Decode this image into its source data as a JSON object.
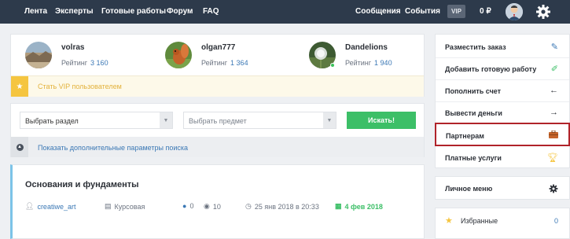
{
  "nav": {
    "links": [
      "Лента",
      "Эксперты",
      "Готовые работы",
      "Форум",
      "FAQ"
    ],
    "messages": "Сообщения",
    "events": "События",
    "vip": "VIP",
    "balance": "0 ₽",
    "settings_icon": "gear-icon"
  },
  "authors": [
    {
      "name": "volras",
      "rating_label": "Рейтинг",
      "rating": "3 160"
    },
    {
      "name": "olgan777",
      "rating_label": "Рейтинг",
      "rating": "1 364"
    },
    {
      "name": "Dandelions",
      "rating_label": "Рейтинг",
      "rating": "1 940"
    }
  ],
  "vip_banner": "Стать VIP пользователем",
  "search": {
    "section_placeholder": "Выбрать раздел",
    "subject_placeholder": "Выбрать предмет",
    "button": "Искать!",
    "more_params": "Показать дополнительные параметры поиска"
  },
  "work": {
    "title": "Основания и фундаменты",
    "author": "creatiwe_art",
    "type": "Курсовая",
    "comments": "0",
    "views": "10",
    "date": "25 янв 2018 в 20:33",
    "deadline": "4 фев 2018"
  },
  "sidebar": {
    "items": [
      {
        "label": "Разместить заказ",
        "icon": "pencil-icon"
      },
      {
        "label": "Добавить готовую работу",
        "icon": "paperclip-icon"
      },
      {
        "label": "Пополнить счет",
        "icon": "arrow-left-icon"
      },
      {
        "label": "Вывести деньги",
        "icon": "arrow-right-icon"
      },
      {
        "label": "Партнерам",
        "icon": "briefcase-icon"
      },
      {
        "label": "Платные услуги",
        "icon": "trophy-icon"
      }
    ],
    "personal_menu": "Личное меню",
    "favorites": "Избранные",
    "favorites_count": "0"
  },
  "colors": {
    "nav_bg": "#2d3a4b",
    "accent_green": "#3cbf67",
    "link_blue": "#3b78b5",
    "highlight_red": "#b0232a",
    "vip_yellow": "#f5c540"
  }
}
